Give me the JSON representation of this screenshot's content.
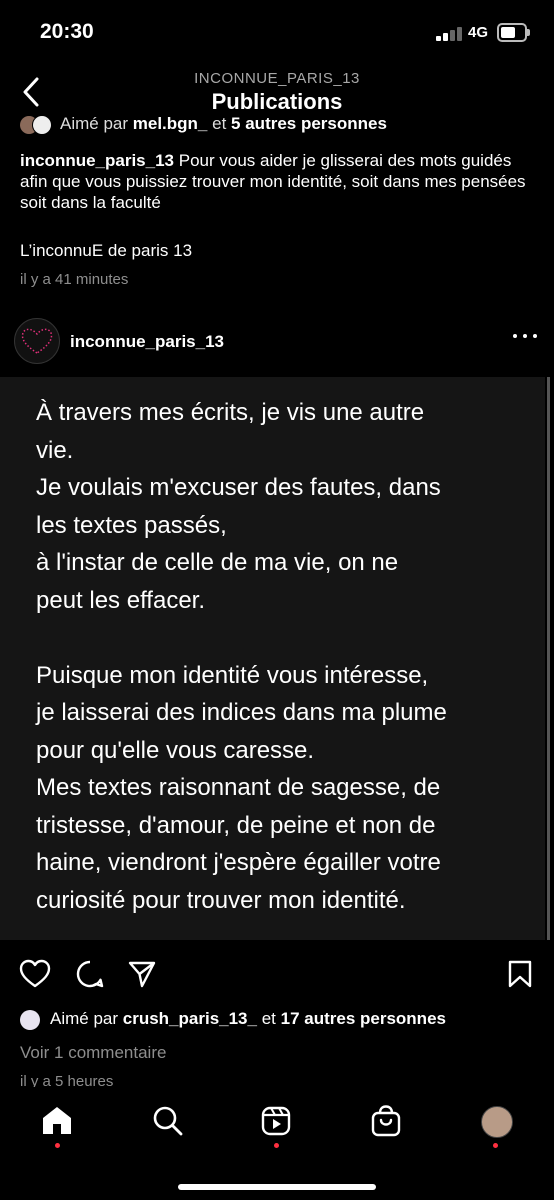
{
  "status_bar": {
    "time": "20:30",
    "network": "4G"
  },
  "nav": {
    "username": "INCONNUE_PARIS_13",
    "title": "Publications"
  },
  "previous_post": {
    "liked_by_prefix": "Aimé par",
    "liked_by_user": "mel.bgn_",
    "liked_by_and": "et",
    "liked_by_others": "5 autres personnes",
    "caption_user": "inconnue_paris_13",
    "caption_text": "Pour vous aider je glisserai des mots guidés afin que vous puissiez trouver mon identité, soit dans mes pensées soit dans la faculté",
    "signature": "L’inconnuE de paris 13",
    "time": "il y a 41 minutes"
  },
  "post": {
    "username": "inconnue_paris_13",
    "text_lines": [
      "À travers mes écrits, je vis une autre",
      "vie.",
      "Je voulais m'excuser des fautes, dans",
      "les textes  passés,",
      "à l'instar de celle de ma vie, on ne",
      "peut les effacer.",
      "",
      "Puisque mon identité vous intéresse,",
      "je laisserai des indices dans ma plume",
      "pour qu'elle vous caresse.",
      "Mes textes raisonnant de sagesse, de",
      "tristesse, d'amour, de peine et non de",
      "haine, viendront j'espère égailler votre",
      "curiosité pour trouver mon identité."
    ],
    "liked_by_prefix": "Aimé par",
    "liked_by_user": "crush_paris_13_",
    "liked_by_and": "et",
    "liked_by_others": "17 autres personnes",
    "comments_link": "Voir 1 commentaire",
    "time": "il y a 5 heures"
  },
  "tabbar": {
    "items": [
      "home-icon",
      "search-icon",
      "reels-icon",
      "shop-icon",
      "profile-avatar"
    ]
  },
  "colors": {
    "notification_dot": "#ff3040",
    "secondary_text": "#8e8e8e"
  }
}
